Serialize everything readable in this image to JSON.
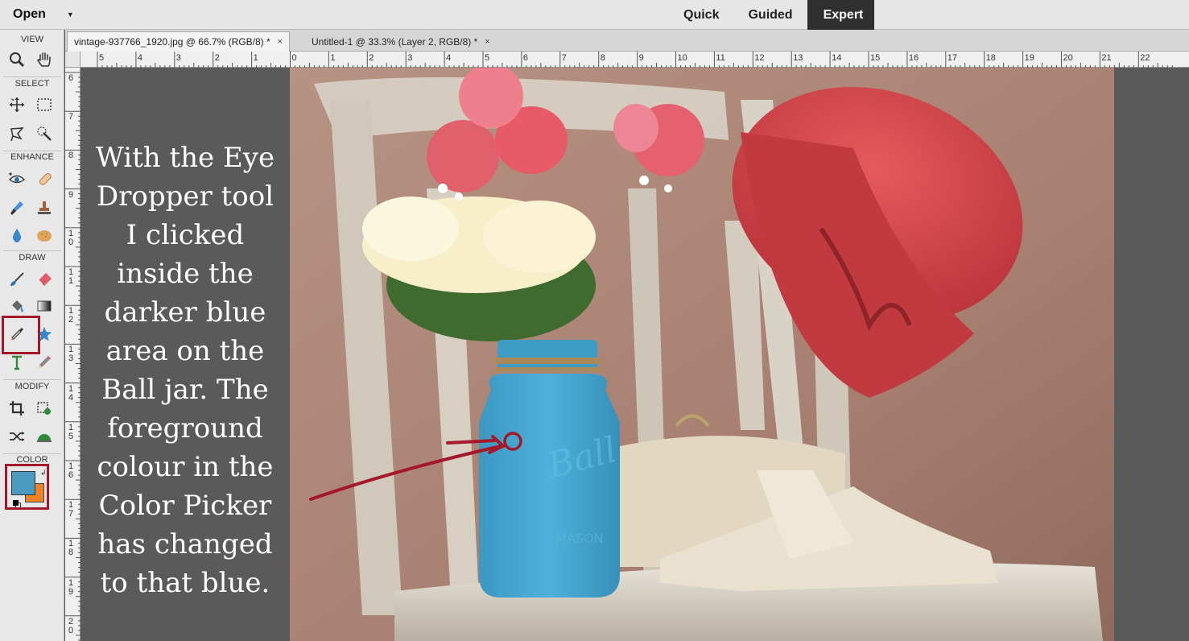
{
  "topbar": {
    "open_label": "Open",
    "modes": [
      "Quick",
      "Guided",
      "Expert"
    ],
    "active_mode": "Expert"
  },
  "toolbox": {
    "sections": {
      "view": "VIEW",
      "select": "SELECT",
      "enhance": "ENHANCE",
      "draw": "DRAW",
      "modify": "MODIFY",
      "color": "COLOR"
    },
    "foreground_color": "#4a9bbf",
    "background_color": "#f0822a",
    "highlight_color": "#a5172b"
  },
  "tabs": [
    {
      "label": "vintage-937766_1920.jpg @ 66.7% (RGB/8) *",
      "close": "×"
    },
    {
      "label": "Untitled-1 @ 33.3% (Layer 2, RGB/8) *",
      "close": "×"
    }
  ],
  "ruler": {
    "top": [
      "5",
      "4",
      "3",
      "2",
      "1",
      "0",
      "1",
      "2",
      "3",
      "4",
      "5",
      "6",
      "7",
      "8",
      "9",
      "10",
      "11",
      "12",
      "13",
      "14",
      "15",
      "16",
      "17",
      "18",
      "19",
      "20",
      "21",
      "22"
    ],
    "left": [
      "6",
      "7",
      "8",
      "9",
      "10",
      "11",
      "12",
      "13",
      "14",
      "15",
      "16",
      "17",
      "18",
      "19",
      "20"
    ]
  },
  "canvas": {
    "caption": "With the Eye Dropper tool I clicked inside the darker blue area on the Ball jar. The foreground colour in the Color Picker has changed to that blue."
  },
  "colors": {
    "sampled_blue": "#4a9bbf",
    "annotation_red": "#a5172b",
    "hat_red": "#d6454a",
    "jar_blue": "#46a7d0"
  }
}
